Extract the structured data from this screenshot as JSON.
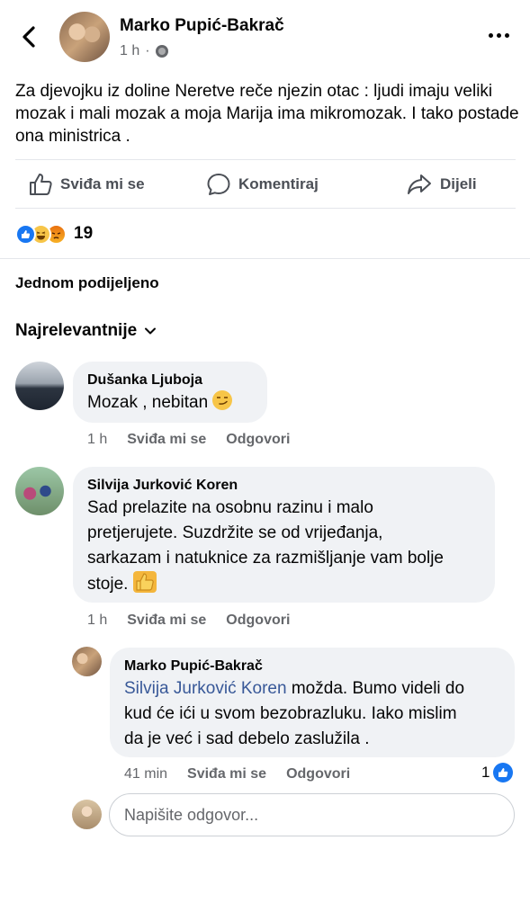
{
  "post": {
    "author": "Marko Pupić-Bakrač",
    "time": "1 h",
    "dot": "·",
    "privacy_icon": "globe-icon",
    "text": "Za djevojku iz doline Neretve reče njezin otac : ljudi imaju veliki mozak i mali mozak a moja Marija ima mikromozak. I tako postade ona ministrica ."
  },
  "actions": {
    "like": "Sviđa mi se",
    "comment": "Komentiraj",
    "share": "Dijeli"
  },
  "reactions": {
    "types": [
      "like",
      "haha",
      "angry"
    ],
    "count": "19"
  },
  "shares_text": "Jednom podijeljeno",
  "sort_label": "Najrelevantnije",
  "comments": [
    {
      "name": "Dušanka Ljuboja",
      "text": "Mozak , nebitan",
      "emoji": "smirk-emoji",
      "time": "1 h",
      "like": "Sviđa mi se",
      "reply": "Odgovori"
    },
    {
      "name": "Silvija Jurković Koren",
      "line1": "Sad prelazite na osobnu razinu i malo",
      "line2": "pretjerujete. Suzdržite se od vrijeđanja,",
      "line3": "sarkazam i natuknice za razmišljanje vam bolje",
      "line4": "stoje.",
      "emoji": "thumbs-up-emoji",
      "time": "1 h",
      "like": "Sviđa mi se",
      "reply": "Odgovori"
    }
  ],
  "reply": {
    "name": "Marko Pupić-Bakrač",
    "mention": "Silvija Jurković Koren",
    "line1_rest": " možda. Bumo videli do",
    "line2": "kud će ići u svom bezobrazluku. Iako mislim",
    "line3": "da je već i sad debelo zaslužila .",
    "time": "41 min",
    "like": "Sviđa mi se",
    "reply": "Odgovori",
    "like_count": "1"
  },
  "reply_input": {
    "placeholder": "Napišite odgovor..."
  },
  "colors": {
    "accent": "#1877f2",
    "mention": "#385898",
    "bubble": "#f0f2f5",
    "secondary_text": "#65676b"
  }
}
